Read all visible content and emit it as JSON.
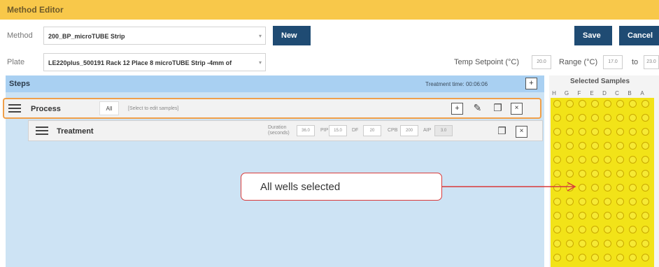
{
  "title": "Method Editor",
  "method": {
    "label": "Method",
    "value": "200_BP_microTUBE Strip"
  },
  "buttons": {
    "new": "New",
    "save": "Save",
    "cancel": "Cancel"
  },
  "plate": {
    "label": "Plate",
    "value": "LE220plus_500191 Rack 12 Place 8 microTUBE Strip -4mm of"
  },
  "temp": {
    "label": "Temp Setpoint (°C)",
    "value": "20.0",
    "range_label": "Range (°C)",
    "range_min": "17.0",
    "to_label": "to",
    "range_max": "23.0"
  },
  "steps": {
    "title": "Steps",
    "treatment_time": "Treatment time: 00:06:06"
  },
  "process": {
    "label": "Process",
    "all": "All",
    "hint": "[Select to edit samples]"
  },
  "treatment": {
    "label": "Treatment",
    "duration_label": "Duration (seconds)",
    "duration": "36.0",
    "pip_label": "PIP",
    "pip": "15.0",
    "df_label": "DF",
    "df": "20",
    "cpb_label": "CPB",
    "cpb": "200",
    "aip_label": "AIP",
    "aip": "3.0"
  },
  "selected_samples": {
    "title": "Selected Samples",
    "columns": [
      "H",
      "G",
      "F",
      "E",
      "D",
      "C",
      "B",
      "A"
    ]
  },
  "callout": {
    "text": "All wells selected"
  },
  "colors": {
    "title_bar": "#f8c84a",
    "accent_button": "#1f4b73",
    "wells": "#f2e318",
    "callout_border": "#d93a3a"
  }
}
